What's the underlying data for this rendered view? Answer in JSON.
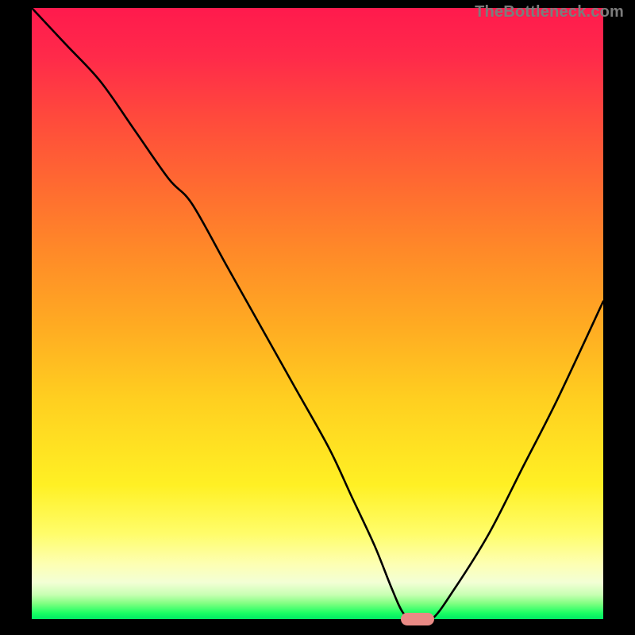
{
  "watermark": {
    "text": "TheBottleneck.com"
  },
  "chart_data": {
    "type": "line",
    "title": "",
    "xlabel": "",
    "ylabel": "",
    "xlim": [
      0,
      100
    ],
    "ylim": [
      0,
      100
    ],
    "grid": false,
    "legend": false,
    "series": [
      {
        "name": "bottleneck-curve",
        "x": [
          0,
          6,
          12,
          18,
          24,
          28,
          34,
          40,
          46,
          52,
          56,
          60,
          63,
          65,
          67,
          70,
          74,
          80,
          86,
          92,
          100
        ],
        "y": [
          100,
          94,
          88,
          80,
          72,
          68,
          58,
          48,
          38,
          28,
          20,
          12,
          5,
          1,
          0,
          0,
          5,
          14,
          25,
          36,
          52
        ],
        "color": "#000000"
      }
    ],
    "marker": {
      "name": "optimal-point",
      "x": 67.5,
      "y": 0,
      "color": "#e98a85"
    },
    "background_gradient": {
      "top": "#ff1a4d",
      "mid1": "#ff8a28",
      "mid2": "#fff024",
      "bottom": "#00e864"
    }
  }
}
